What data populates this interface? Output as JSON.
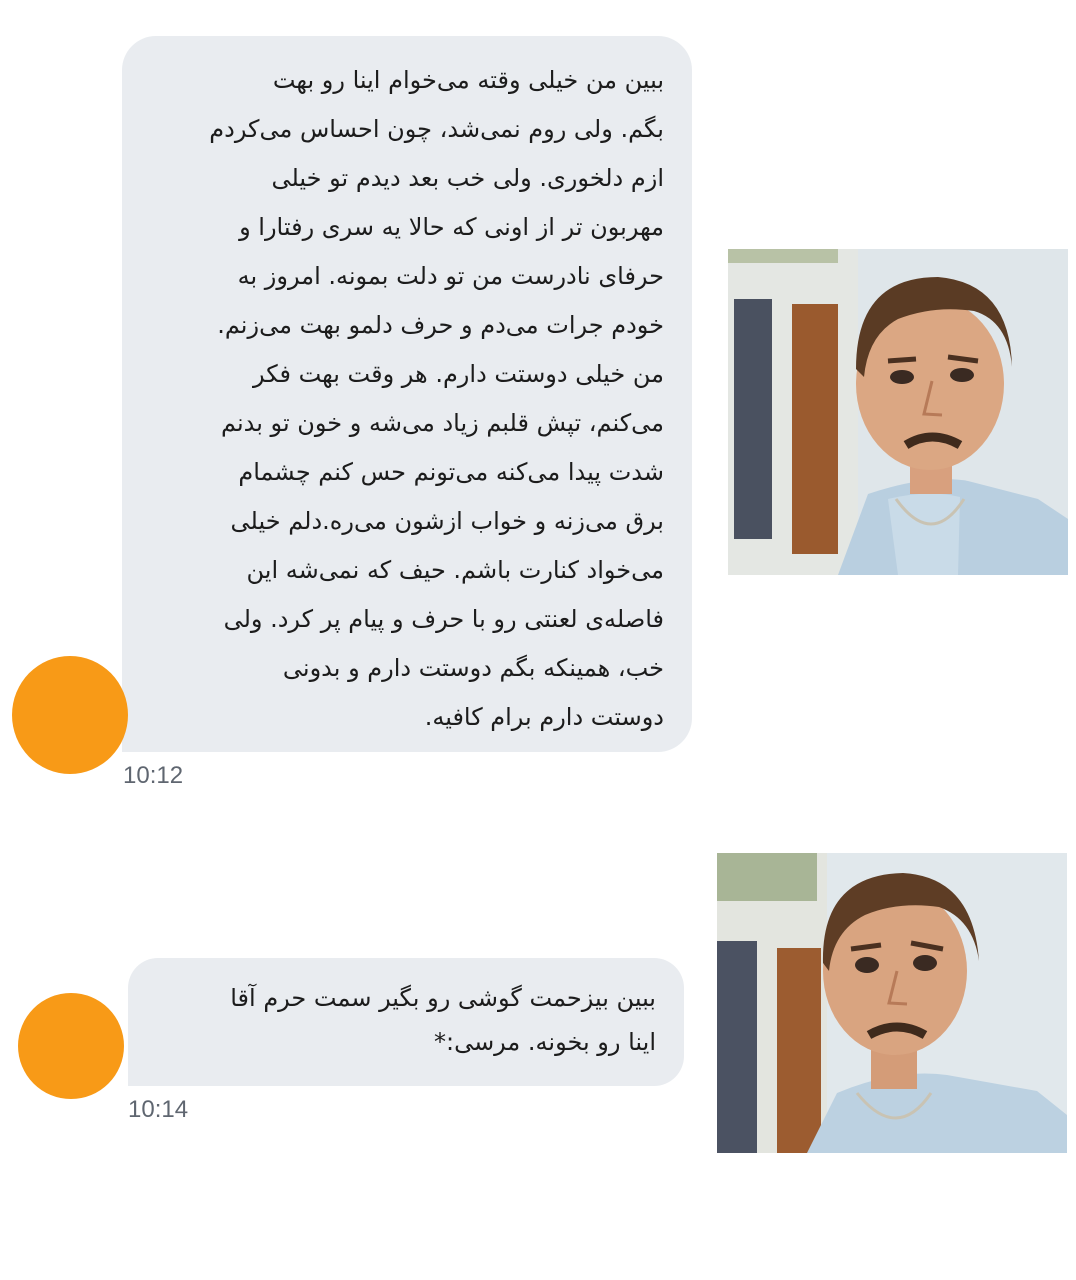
{
  "messages": [
    {
      "lines": [
        "ببین من خیلی وقته می‌خوام اینا رو بهت",
        "بگم. ولی روم نمی‌شد، چون احساس می‌کردم",
        "ازم دلخوری. ولی خب بعد دیدم تو خیلی",
        "مهربون تر از اونی که حالا یه سری رفتارا و",
        "حرفای نادرست من تو دلت بمونه. امروز به",
        "خودم جرات می‌دم و حرف دلمو بهت می‌زنم.",
        "من خیلی دوستت دارم. هر وقت بهت فکر",
        "می‌کنم، تپش قلبم زیاد می‌شه و خون تو بدنم",
        "شدت پیدا می‌کنه می‌تونم حس کنم چشمام",
        "برق می‌زنه و خواب ازشون می‌ره.دلم خیلی",
        "می‌خواد کنارت باشم. حیف که نمی‌شه این",
        "فاصله‌ی لعنتی رو با حرف و پیام پر کرد. ولی",
        "خب، همینکه بگم دوستت دارم و بدونی",
        "دوستت دارم برام کافیه."
      ],
      "time": "10:12"
    },
    {
      "lines": [
        "ببین بیزحمت گوشی رو بگیر سمت حرم آقا",
        "اینا رو بخونه. مرسی:*"
      ],
      "time": "10:14"
    }
  ],
  "colors": {
    "bubble": "#e9ecf0",
    "avatar": "#f89a17",
    "timestamp": "#5f6670",
    "text": "#1c1c1c"
  },
  "icons": [
    "avatar-circle",
    "reaction-photo"
  ]
}
